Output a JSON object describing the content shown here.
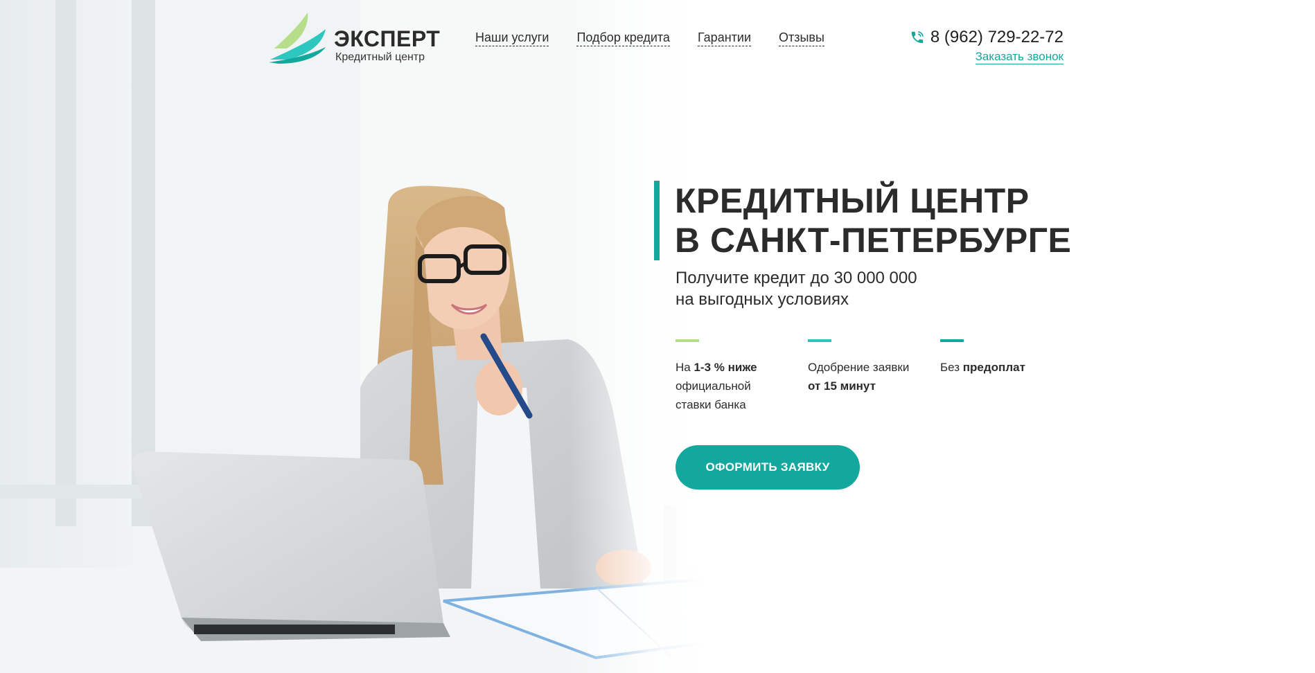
{
  "header": {
    "logo": {
      "title": "ЭКСПЕРТ",
      "subtitle": "Кредитный центр"
    },
    "nav": [
      {
        "label": "Наши услуги"
      },
      {
        "label": "Подбор кредита"
      },
      {
        "label": "Гарантии"
      },
      {
        "label": "Отзывы"
      }
    ],
    "contact": {
      "phone": "8 (962) 729-22-72",
      "callback_label": "Заказать звонок"
    }
  },
  "hero": {
    "title_line1": "КРЕДИТНЫЙ ЦЕНТР",
    "title_line2": "В САНКТ-ПЕТЕРБУРГЕ",
    "subtitle_line1": "Получите кредит до 30 000 000",
    "subtitle_line2": "на выгодных условиях",
    "features": [
      {
        "parts": [
          "На ",
          "1-3 % ниже",
          "официальной",
          "ставки банка"
        ],
        "accent": "#b5dd8a"
      },
      {
        "parts": [
          "Одобрение заявки",
          "от 15 минут"
        ],
        "accent": "#2ec7c0"
      },
      {
        "parts": [
          "Без ",
          "предоплат"
        ],
        "accent": "#13a89e"
      }
    ],
    "cta_label": "ОФОРМИТЬ ЗАЯВКУ"
  },
  "colors": {
    "brand": "#13a89e",
    "brand_light": "#2ec7c0",
    "accent_green": "#b5dd8a",
    "text": "#2b2b2b"
  },
  "icons": {
    "logo": "wing-logo-icon",
    "phone": "phone-icon"
  }
}
